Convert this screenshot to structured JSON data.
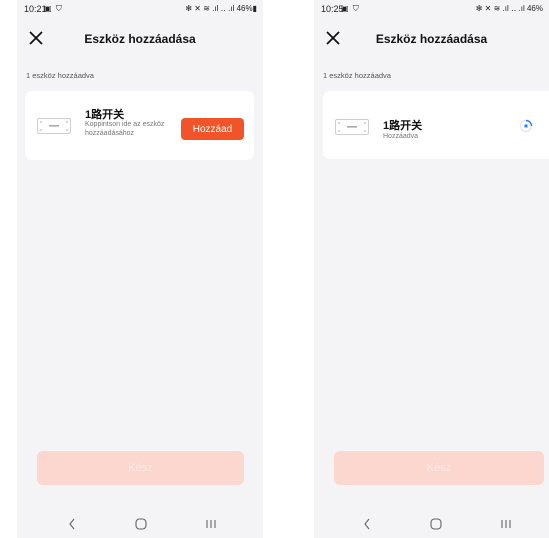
{
  "screens": [
    {
      "status": {
        "time": "10:21",
        "left_icons": "▣ ⛉",
        "right": "✻ ✕ ≋ .ıl ‥ .ıl 46%▮"
      },
      "title": "Eszköz hozzáadása",
      "count_label": "1 eszköz hozzáadva",
      "device": {
        "name": "1路开关",
        "subtitle": "Koppintson ide az eszköz hozzáadásához"
      },
      "add_button": "Hozzáad",
      "done_button": "Kész"
    },
    {
      "status": {
        "time": "10:25",
        "left_icons": "▣ ⛉",
        "right": "✻ ✕ ≋ .ıl ‥ .ıl 46%"
      },
      "title": "Eszköz hozzáadása",
      "count_label": "1 eszköz hozzáadva",
      "device": {
        "name": "1路开关",
        "subtitle": "Hozzáadva"
      },
      "done_button": "Kész"
    }
  ],
  "colors": {
    "accent": "#f2542a",
    "done_disabled": "#fbd7d0",
    "spinner": "#2f7ff0",
    "background": "#f4f4f6"
  }
}
